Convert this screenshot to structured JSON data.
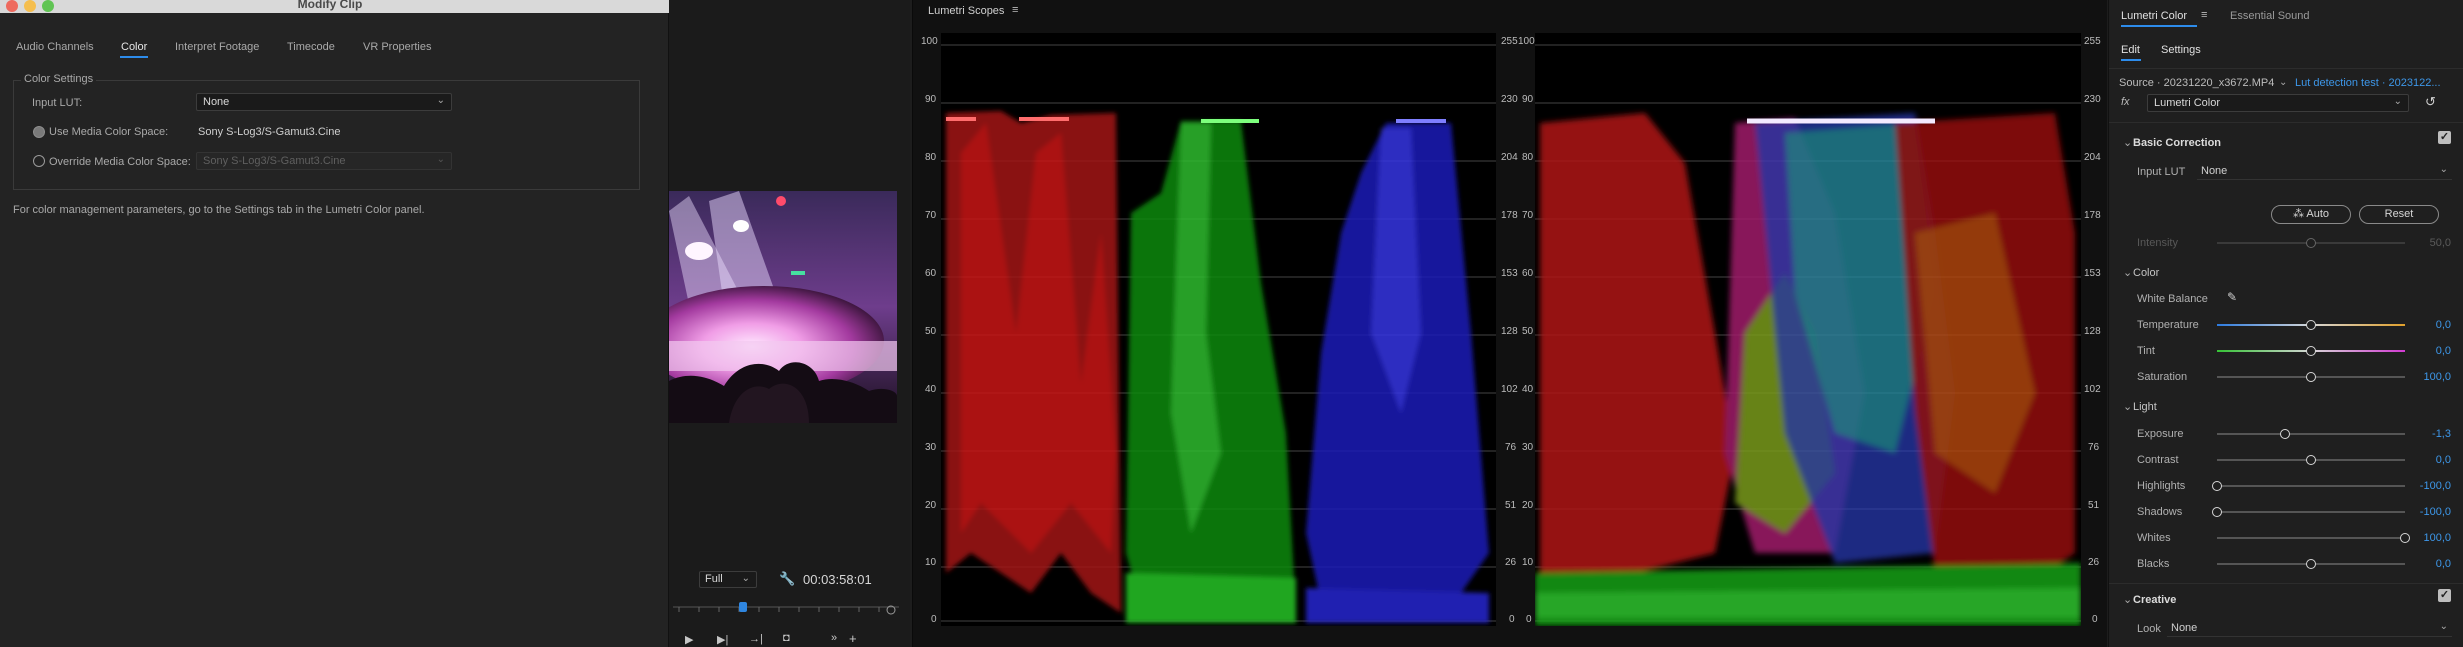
{
  "dialog": {
    "title": "Modify Clip",
    "tabs": [
      "Audio Channels",
      "Color",
      "Interpret Footage",
      "Timecode",
      "VR Properties"
    ],
    "active_tab": "Color",
    "color_settings_legend": "Color Settings",
    "input_lut_label": "Input LUT:",
    "input_lut_value": "None",
    "use_media_label": "Use Media Color Space:",
    "use_media_value": "Sony S-Log3/S-Gamut3.Cine",
    "override_label": "Override Media Color Space:",
    "override_value": "Sony S-Log3/S-Gamut3.Cine",
    "note": "For color management parameters, go to the Settings tab in the Lumetri Color panel."
  },
  "monitor": {
    "zoom": "Full",
    "timecode": "00:03:58:01"
  },
  "scopes": {
    "title": "Lumetri Scopes",
    "left_ticks": [
      "100",
      "90",
      "80",
      "70",
      "60",
      "50",
      "40",
      "30",
      "20",
      "10",
      "0"
    ],
    "right_ticks": [
      "255",
      "230",
      "204",
      "178",
      "153",
      "128",
      "102",
      "76",
      "51",
      "26",
      "0"
    ]
  },
  "lumetri": {
    "panel_title": "Lumetri Color",
    "other_panel": "Essential Sound",
    "subtabs": [
      "Edit",
      "Settings"
    ],
    "source": "Source · 20231220_x3672.MP4",
    "sequence": "Lut detection test · 2023122...",
    "effect": "Lumetri Color",
    "basic_correction": "Basic Correction",
    "input_lut_label": "Input LUT",
    "input_lut_value": "None",
    "auto_label": "Auto",
    "reset_label": "Reset",
    "intensity_label": "Intensity",
    "intensity_value": "50,0",
    "color_section": "Color",
    "white_balance_label": "White Balance",
    "light_section": "Light",
    "creative_section": "Creative",
    "look_label": "Look",
    "look_value": "None",
    "sliders": [
      {
        "label": "Temperature",
        "value": "0,0",
        "pos": 0.5
      },
      {
        "label": "Tint",
        "value": "0,0",
        "pos": 0.5
      },
      {
        "label": "Saturation",
        "value": "100,0",
        "pos": 0.5
      },
      {
        "label": "Exposure",
        "value": "-1,3",
        "pos": 0.36
      },
      {
        "label": "Contrast",
        "value": "0,0",
        "pos": 0.5
      },
      {
        "label": "Highlights",
        "value": "-100,0",
        "pos": 0.0
      },
      {
        "label": "Shadows",
        "value": "-100,0",
        "pos": 0.0
      },
      {
        "label": "Whites",
        "value": "100,0",
        "pos": 1.0
      },
      {
        "label": "Blacks",
        "value": "0,0",
        "pos": 0.5
      }
    ]
  }
}
